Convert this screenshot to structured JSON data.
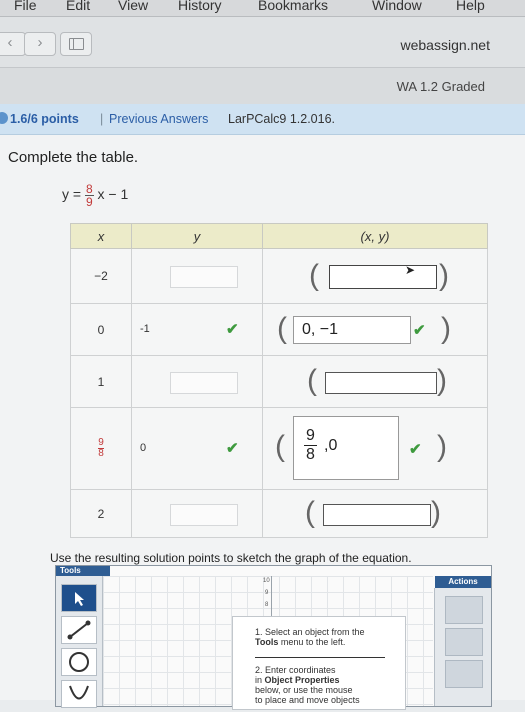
{
  "menubar": {
    "items": [
      "File",
      "Edit",
      "View",
      "History",
      "Bookmarks",
      "Window",
      "Help"
    ]
  },
  "browser": {
    "url": "webassign.net",
    "tab_label": "WA 1.2 Graded"
  },
  "question": {
    "points": "1.6/6 points",
    "separator": "|",
    "previous_answers": "Previous Answers",
    "course_ref": "LarPCalc9 1.2.016.",
    "prompt": "Complete the table.",
    "equation": {
      "lhs": "y =",
      "frac_num": "8",
      "frac_den": "9",
      "rhs": "x − 1"
    },
    "table": {
      "headers": [
        "x",
        "y",
        "(x, y)"
      ],
      "rows": [
        {
          "x": "−2",
          "y": "",
          "pair": ""
        },
        {
          "x": "0",
          "y": "-1",
          "pair": "0, −1"
        },
        {
          "x": "1",
          "y": "",
          "pair": ""
        },
        {
          "x_num": "9",
          "x_den": "8",
          "y": "0",
          "pair_num": "9",
          "pair_den": "8",
          "pair_tail": ",0"
        },
        {
          "x": "2",
          "y": "",
          "pair": ""
        }
      ],
      "paren_open": "(",
      "paren_close": ")"
    },
    "instruction": "Use the resulting solution points to sketch the graph of the equation."
  },
  "graph_tool": {
    "tools_label": "Tools",
    "actions_label": "Actions",
    "y_ticks": [
      "10",
      "9",
      "8"
    ],
    "help_step1_line1": "1. Select an object from the",
    "help_step1_bold": "Tools",
    "help_step1_line2": "menu to the left.",
    "help_step2_line1": "2. Enter coordinates",
    "help_step2_line2": "in",
    "help_step2_bold": "Object Properties",
    "help_step2_line3": "below, or use the mouse",
    "help_step2_line4": "to place and move objects"
  },
  "colors": {
    "accent": "#2b5ea6",
    "check": "#3e9a3e",
    "header_fill": "#ecebc9",
    "panel_blue": "#2f5d93"
  },
  "icons": {
    "check": "check-icon",
    "cursor": "arrow-cursor-icon",
    "back": "back-icon",
    "forward": "forward-icon"
  }
}
